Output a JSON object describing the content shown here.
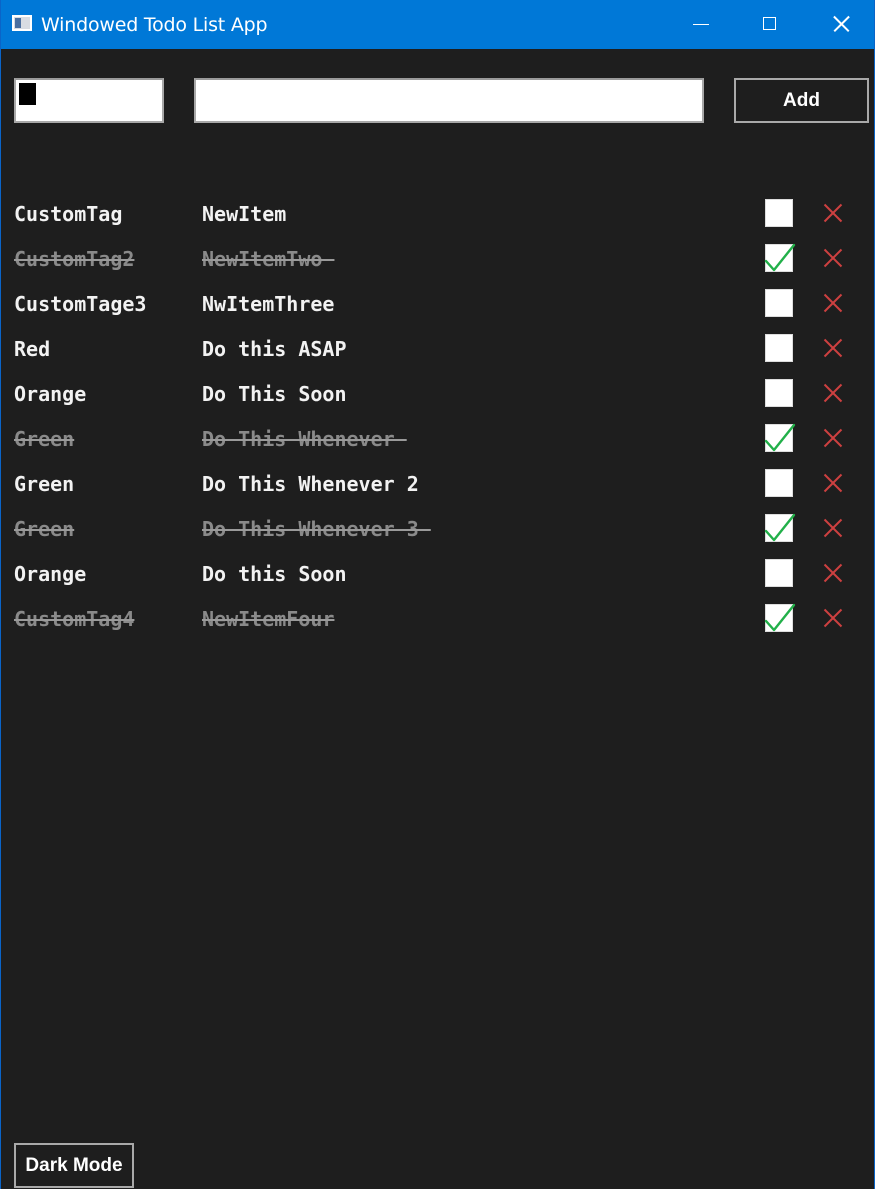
{
  "window": {
    "title": "Windowed Todo List App",
    "accent_color": "#0078d7",
    "icons": {
      "app": "window-app-icon",
      "minimize": "minimize-icon",
      "maximize": "maximize-icon",
      "close": "close-icon"
    }
  },
  "form": {
    "tag_value": "",
    "item_value": "",
    "add_label": "Add"
  },
  "todos": [
    {
      "tag": "CustomTag",
      "item": "NewItem",
      "done": false
    },
    {
      "tag": "CustomTag2",
      "item": "NewItemTwo ",
      "done": true
    },
    {
      "tag": "CustomTage3",
      "item": "NwItemThree",
      "done": false
    },
    {
      "tag": "Red",
      "item": "Do this ASAP",
      "done": false
    },
    {
      "tag": "Orange",
      "item": "Do This Soon",
      "done": false
    },
    {
      "tag": "Green",
      "item": "Do This Whenever ",
      "done": true
    },
    {
      "tag": "Green",
      "item": "Do This Whenever 2",
      "done": false
    },
    {
      "tag": "Green",
      "item": "Do This Whenever 3 ",
      "done": true
    },
    {
      "tag": "Orange",
      "item": "Do this Soon",
      "done": false
    },
    {
      "tag": "CustomTag4",
      "item": "NewItemFour",
      "done": true
    }
  ],
  "colors": {
    "background": "#1e1e1e",
    "text": "#f2f2f2",
    "done_text": "#8a8a8a",
    "check_color": "#22b04a",
    "delete_color": "#cd4040"
  },
  "footer": {
    "dark_mode_label": "Dark Mode"
  }
}
